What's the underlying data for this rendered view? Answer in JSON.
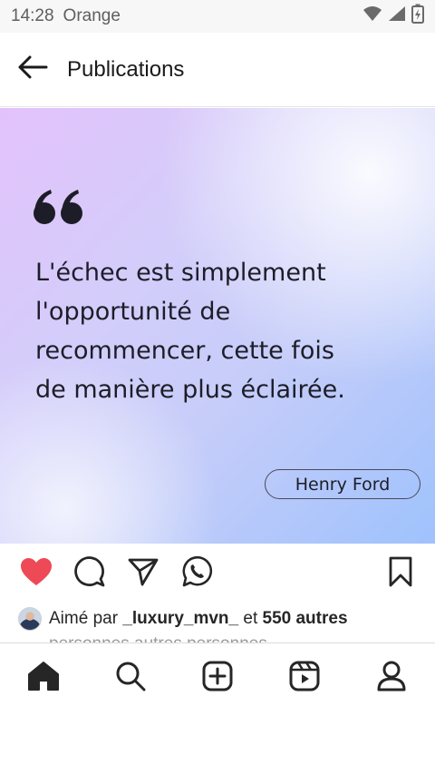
{
  "status_bar": {
    "time": "14:28",
    "carrier": "Orange"
  },
  "header": {
    "title": "Publications"
  },
  "post": {
    "quote": "L'échec est simplement\nl'opportunité de\nrecommencer, cette fois\nde manière plus éclairée.",
    "author": "Henry Ford"
  },
  "likes": {
    "prefix": "Aimé par ",
    "user": "_luxury_mvn_",
    "middle": " et ",
    "count_text": "550 autres",
    "overflow": "personnes autres personnes"
  },
  "colors": {
    "heart": "#ed4956",
    "icon": "#262626"
  },
  "icons": [
    "back-arrow-icon",
    "heart-icon",
    "comment-icon",
    "share-icon",
    "whatsapp-icon",
    "bookmark-icon",
    "home-icon",
    "search-icon",
    "add-post-icon",
    "reels-icon",
    "profile-icon"
  ]
}
